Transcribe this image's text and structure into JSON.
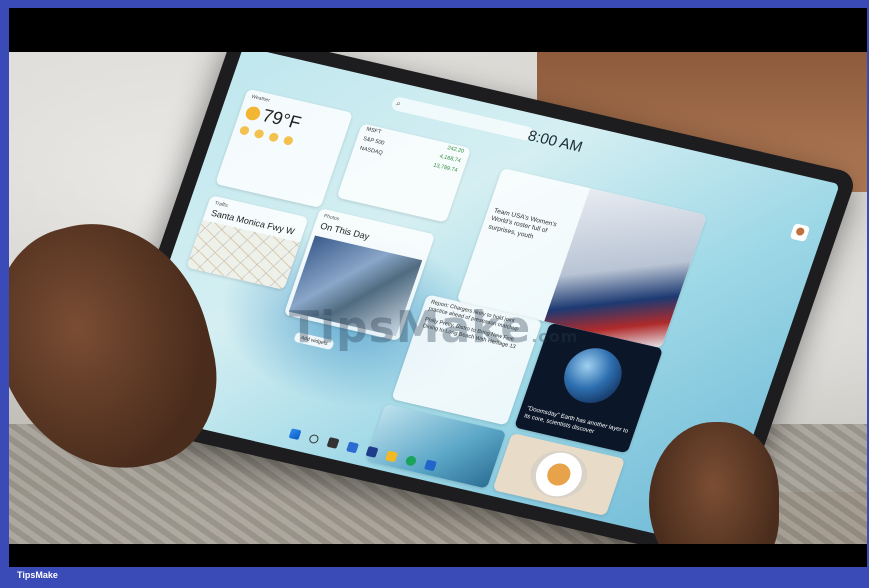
{
  "watermark": {
    "text": "TipsMake",
    "suffix": ".com"
  },
  "brand": "TipsMake",
  "tablet": {
    "clock": "8:00 AM",
    "weather": {
      "header": "Weather",
      "temp": "79",
      "unit": "°F"
    },
    "traffic": {
      "header": "Traffic",
      "title": "Santa Monica Fwy W"
    },
    "onthisday": {
      "header": "Photos",
      "title": "On This Day"
    },
    "edit_button": "Add widgets",
    "stocks": {
      "rows": [
        {
          "name": "MSFT",
          "value": "242.20"
        },
        {
          "name": "S&P 500",
          "value": "4,168.74"
        },
        {
          "name": "NASDAQ",
          "value": "13,789.74"
        }
      ]
    },
    "news": {
      "text": "Team USA's Women's World's roster full of surprises, youth"
    },
    "list_items": [
      "Report: Chargers likely to hold joint practice ahead of preseason matchup",
      "Philly Pretty, Bistro to Bring New Fine Dining to Long Beach With Heritage 13"
    ],
    "earth_caption": "\"Doomsday\" Earth has another layer to its core, scientists discover"
  },
  "colors": {
    "frame": "#3a4bb7",
    "letterbox": "#000000"
  }
}
